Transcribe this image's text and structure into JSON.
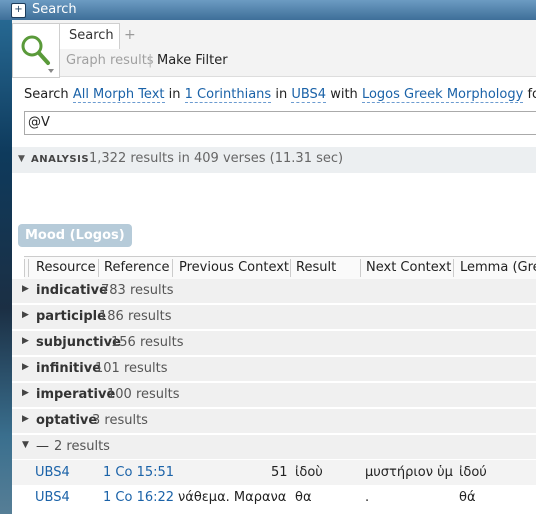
{
  "window": {
    "title": "Search"
  },
  "tabs": {
    "search": "Search",
    "add": "+"
  },
  "toolbar": {
    "graph_results": "Graph results",
    "separator": "|",
    "make_filter": "Make Filter"
  },
  "query": {
    "prefix": "Search",
    "text_scope": "All Morph Text",
    "in1": "in",
    "book": "1 Corinthians",
    "in2": "in",
    "edition": "UBS4",
    "with": "with",
    "morphology": "Logos Greek Morphology",
    "for": "for"
  },
  "search": {
    "value": "@V"
  },
  "analysis": {
    "label": "ANALYSIS",
    "summary": "1,322 results in 409 verses (11.31 sec)"
  },
  "mood_chip": "Mood (Logos)",
  "columns": [
    "Resource",
    "Reference",
    "Previous Context",
    "Result",
    "Next Context",
    "Lemma (Gre"
  ],
  "groups": [
    {
      "name": "indicative",
      "count": "783 results"
    },
    {
      "name": "participle",
      "count": "186 results"
    },
    {
      "name": "subjunctive",
      "count": "156 results"
    },
    {
      "name": "infinitive",
      "count": "101 results"
    },
    {
      "name": "imperative",
      "count": "100 results"
    },
    {
      "name": "optative",
      "count": "3 results"
    },
    {
      "name": "—",
      "count": "2 results"
    }
  ],
  "rows": [
    {
      "resource": "UBS4",
      "reference": "1 Co 15:51",
      "previous": "51",
      "result": "ἰδοὺ",
      "next": "μυστήριον ὑμ",
      "lemma": "ἰδού"
    },
    {
      "resource": "UBS4",
      "reference": "1 Co 16:22",
      "previous": "νάθεμα. Μαρανα",
      "result": "θα",
      "next": ".",
      "lemma": "θά"
    }
  ]
}
